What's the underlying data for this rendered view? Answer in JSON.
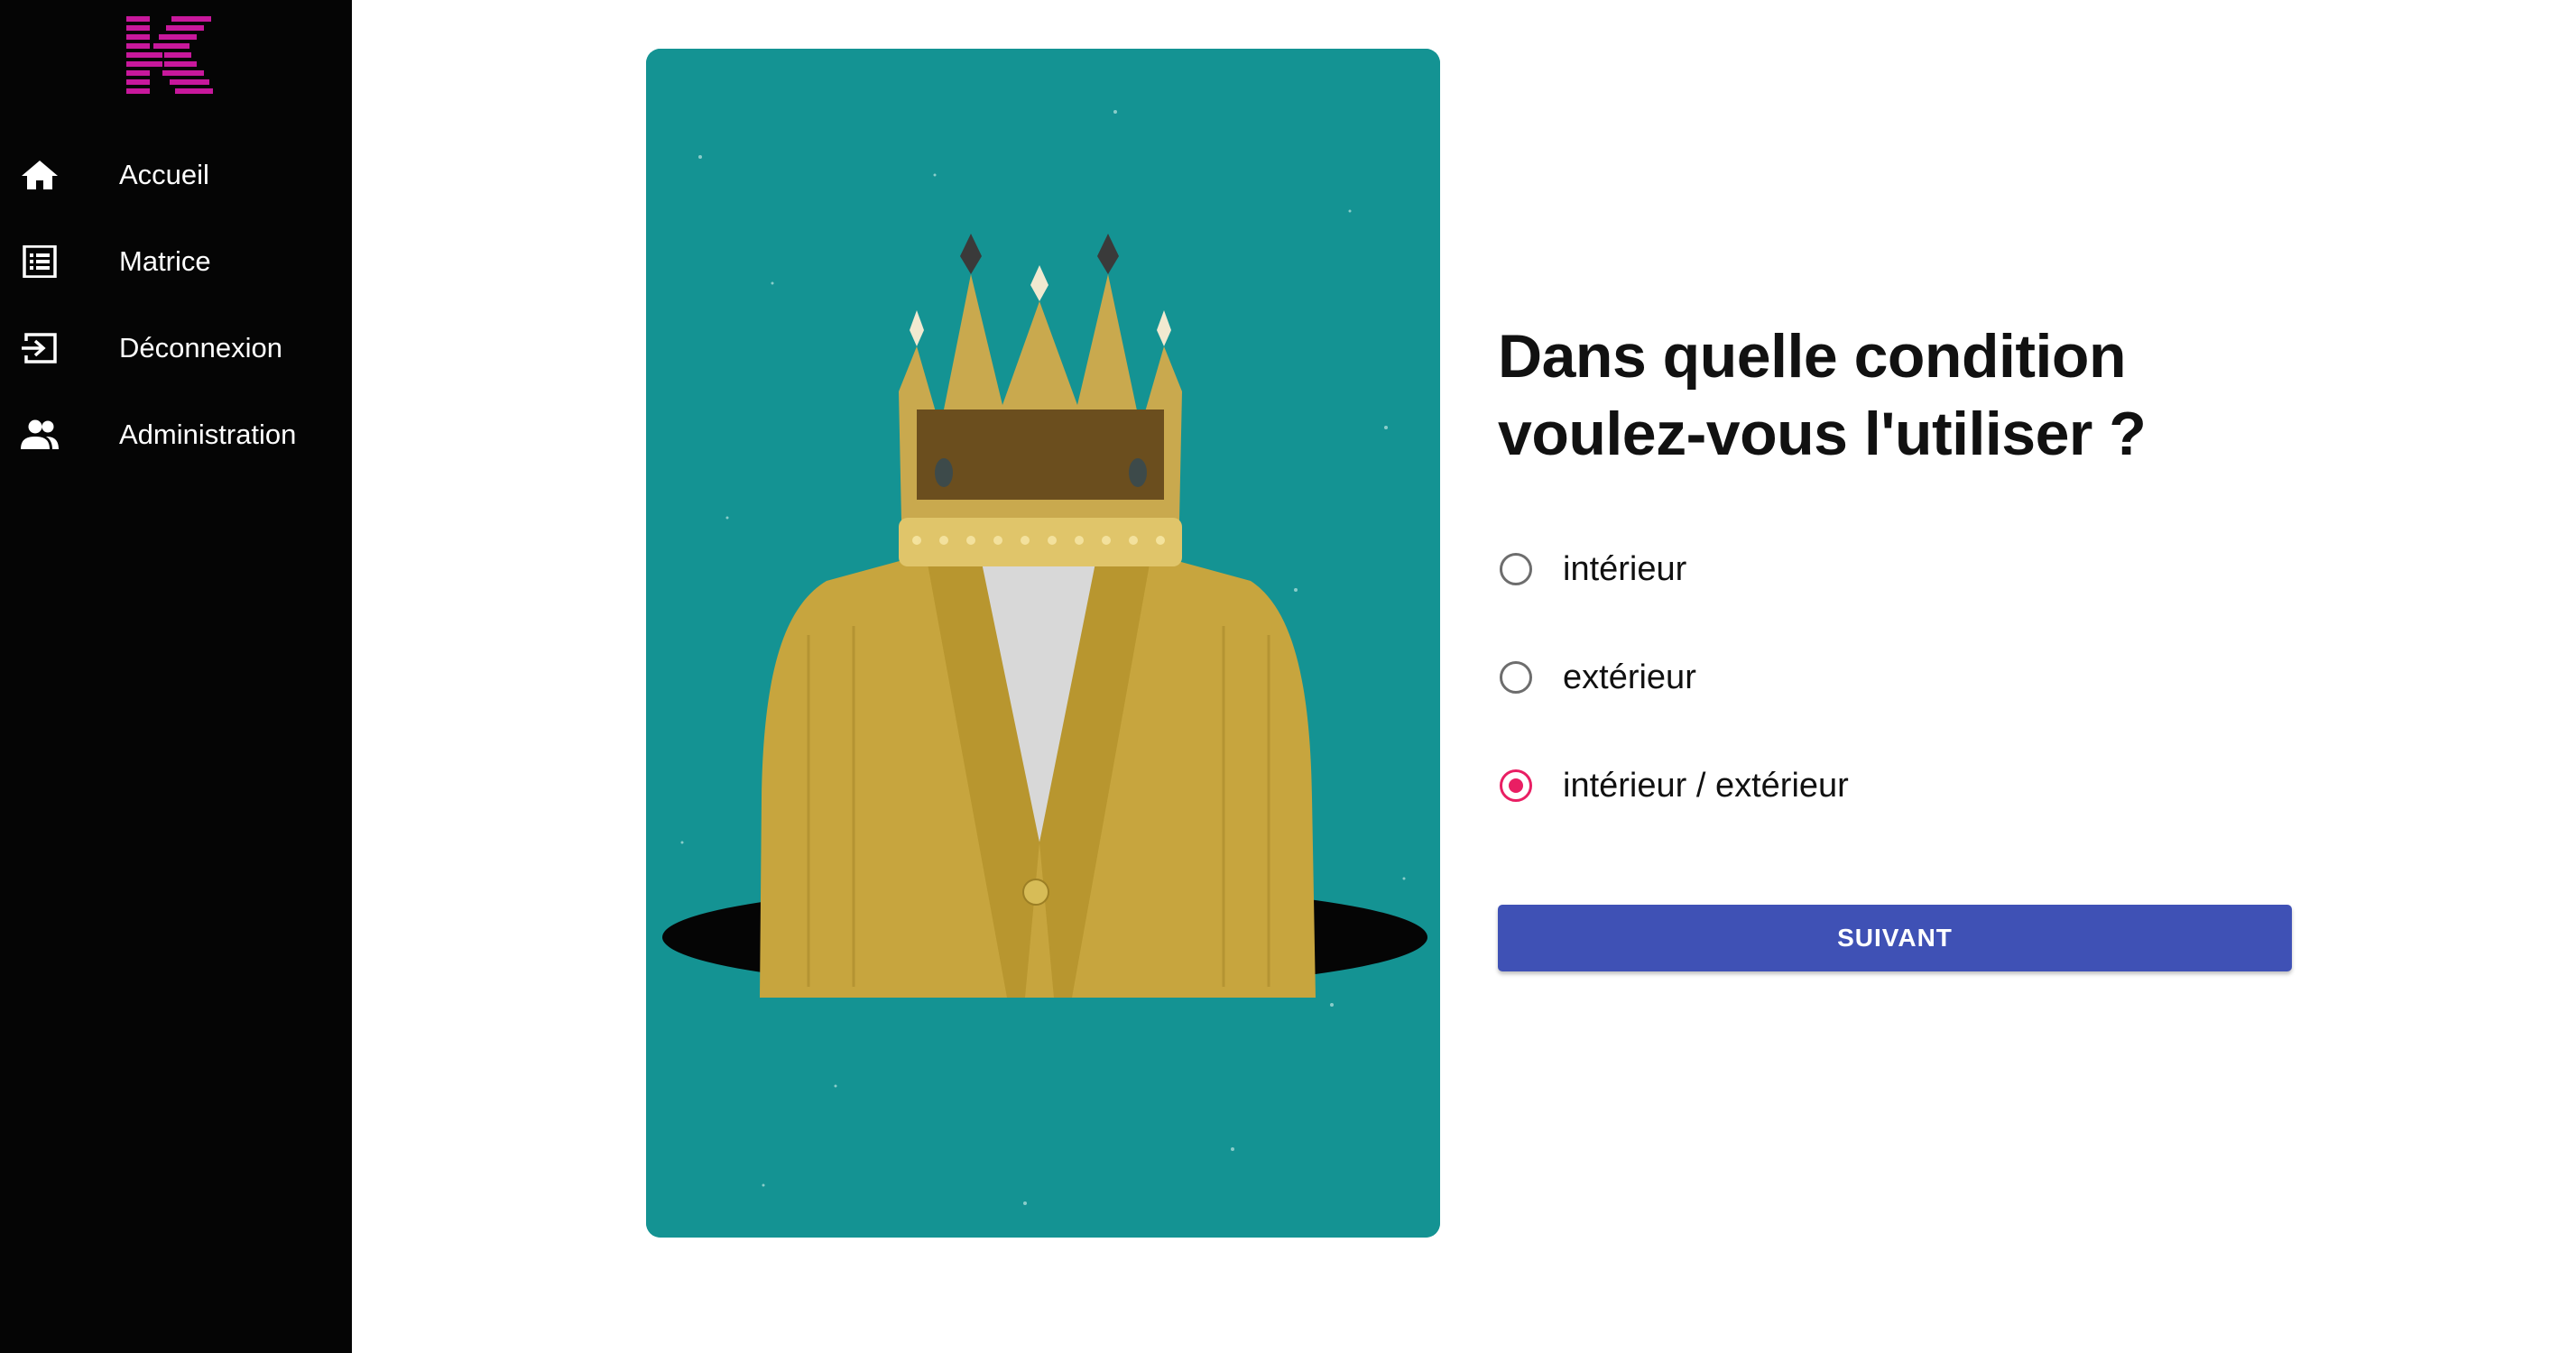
{
  "colors": {
    "sidebar_bg": "#050505",
    "logo_magenta": "#c8189c",
    "card_teal": "#149393",
    "radio_selected": "#e91e63",
    "radio_unselected": "#6d6d6d",
    "button_bg": "#3f51b5",
    "button_text": "#ffffff"
  },
  "sidebar": {
    "logo_icon": "k-logo-icon",
    "items": [
      {
        "label": "Accueil",
        "icon": "home-icon"
      },
      {
        "label": "Matrice",
        "icon": "list-icon"
      },
      {
        "label": "Déconnexion",
        "icon": "logout-icon"
      },
      {
        "label": "Administration",
        "icon": "people-icon"
      }
    ]
  },
  "hero": {
    "image": "crown-cardigan-illustration"
  },
  "question": {
    "title": "Dans quelle condition voulez-vous l'utiliser ?",
    "options": [
      {
        "label": "intérieur",
        "selected": false
      },
      {
        "label": "extérieur",
        "selected": false
      },
      {
        "label": "intérieur / extérieur",
        "selected": true
      }
    ],
    "next_label": "SUIVANT"
  }
}
